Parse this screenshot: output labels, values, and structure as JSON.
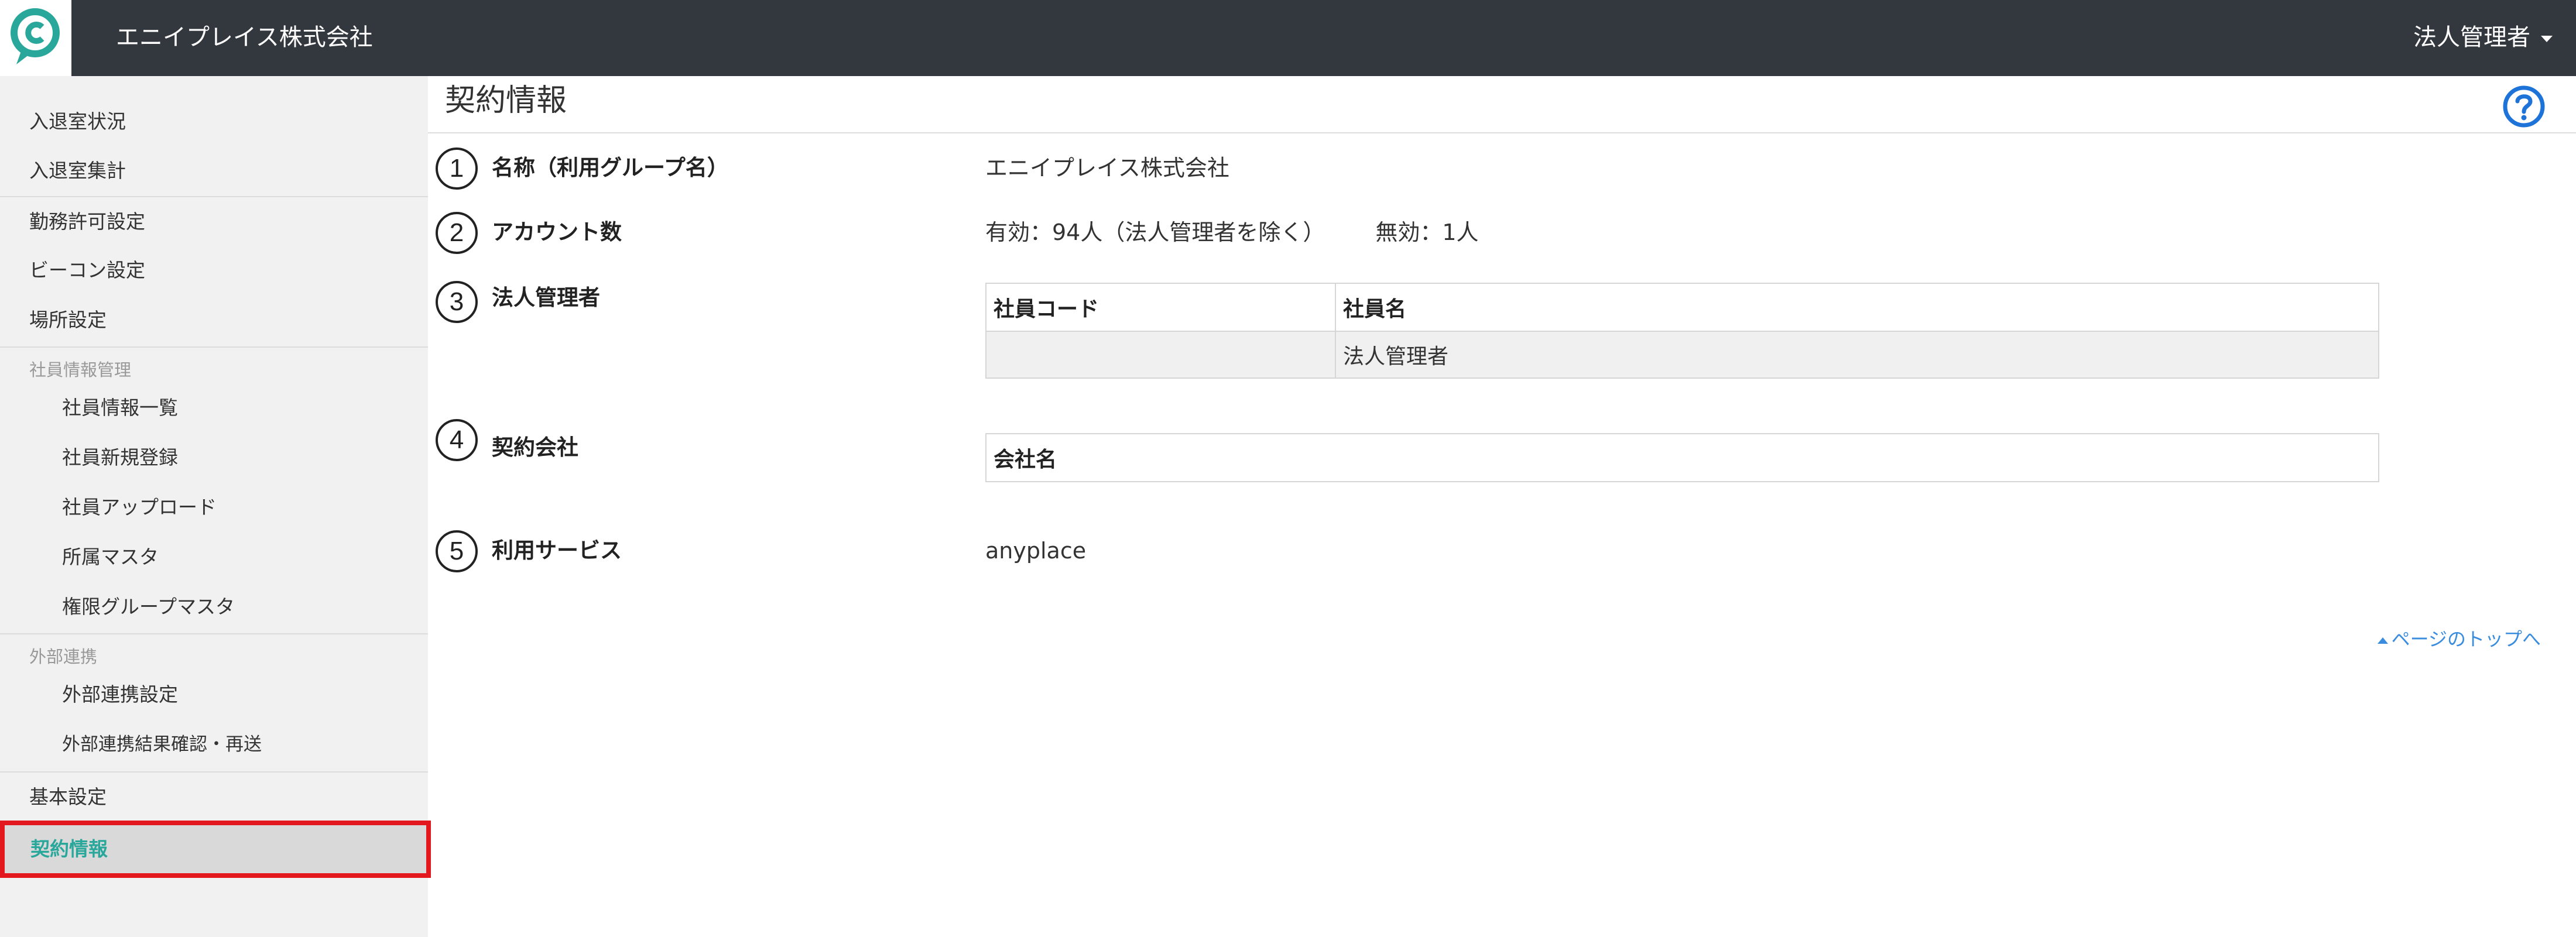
{
  "header": {
    "company_name": "エニイプレイス株式会社",
    "user_menu_label": "法人管理者",
    "logo_icon": "anyplace-logo-icon",
    "brand_color": "#2aa79b",
    "background_color": "#33373e"
  },
  "sidebar": {
    "items": [
      {
        "label": "入退室状況"
      },
      {
        "label": "入退室集計"
      },
      {
        "label": "勤務許可設定"
      },
      {
        "label": "ビーコン設定"
      },
      {
        "label": "場所設定"
      }
    ],
    "employee_section": {
      "title": "社員情報管理",
      "items": [
        {
          "label": "社員情報一覧"
        },
        {
          "label": "社員新規登録"
        },
        {
          "label": "社員アップロード"
        },
        {
          "label": "所属マスタ"
        },
        {
          "label": "権限グループマスタ"
        }
      ]
    },
    "external_section": {
      "title": "外部連携",
      "items": [
        {
          "label": "外部連携設定"
        },
        {
          "label": "外部連携結果確認・再送"
        }
      ]
    },
    "basic_settings": "基本設定",
    "active_item": "契約情報",
    "active_color": "#2aa79b",
    "highlight_color": "#e3171e"
  },
  "main": {
    "title": "契約情報",
    "help_icon": "question-circle-icon",
    "rows": [
      {
        "number": "1",
        "label": "名称（利用グループ名）",
        "value": "エニイプレイス株式会社"
      },
      {
        "number": "2",
        "label": "アカウント数",
        "value_active": "有効：94人（法人管理者を除く）",
        "value_inactive": "無効：1人"
      },
      {
        "number": "3",
        "label": "法人管理者",
        "table": {
          "headers": [
            "社員コード",
            "社員名"
          ],
          "rows": [
            [
              "",
              "法人管理者"
            ]
          ]
        }
      },
      {
        "number": "4",
        "label": "契約会社",
        "table": {
          "headers": [
            "会社名"
          ],
          "rows": []
        }
      },
      {
        "number": "5",
        "label": "利用サービス",
        "value": "anyplace"
      }
    ],
    "back_to_top": "ページのトップへ",
    "link_color": "#3a8dde"
  }
}
